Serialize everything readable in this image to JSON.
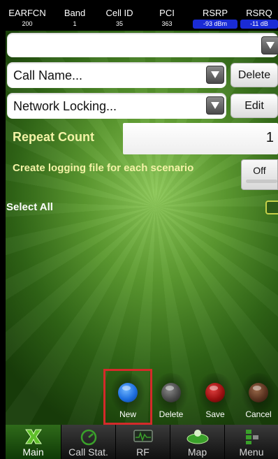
{
  "status_bar": {
    "columns": [
      {
        "header": "EARFCN",
        "value": "200"
      },
      {
        "header": "Band",
        "value": "1"
      },
      {
        "header": "Cell ID",
        "value": "35"
      },
      {
        "header": "PCI",
        "value": "363"
      },
      {
        "header": "RSRP",
        "value": "-93 dBm"
      },
      {
        "header": "RSRQ",
        "value": "-11 dB"
      }
    ]
  },
  "scenario_select": {
    "value": ""
  },
  "call_name": {
    "value": "Call Name...",
    "button": "Delete"
  },
  "network_locking": {
    "value": "Network Locking...",
    "button": "Edit"
  },
  "repeat_count": {
    "label": "Repeat Count",
    "value": "1"
  },
  "logging": {
    "label": "Create logging file for each scenario",
    "toggle": "Off"
  },
  "select_all": {
    "label": "Select All"
  },
  "actions": [
    {
      "label": "New",
      "color": "#1e6fe0"
    },
    {
      "label": "Delete",
      "color": "#4a4a4a"
    },
    {
      "label": "Save",
      "color": "#9a1010"
    },
    {
      "label": "Cancel",
      "color": "#5a3320"
    }
  ],
  "nav_tabs": [
    {
      "label": "Main",
      "icon": "x-logo-icon"
    },
    {
      "label": "Call Stat.",
      "icon": "gauge-icon"
    },
    {
      "label": "RF",
      "icon": "waveform-icon"
    },
    {
      "label": "Map",
      "icon": "map-icon"
    },
    {
      "label": "Menu",
      "icon": "menu-blocks-icon"
    }
  ],
  "colors": {
    "highlight": "#d42a2a",
    "accent_green": "#3a8a1e",
    "label_yellow": "#f4f3a6",
    "rsrp_blue": "#1a2bd6"
  }
}
